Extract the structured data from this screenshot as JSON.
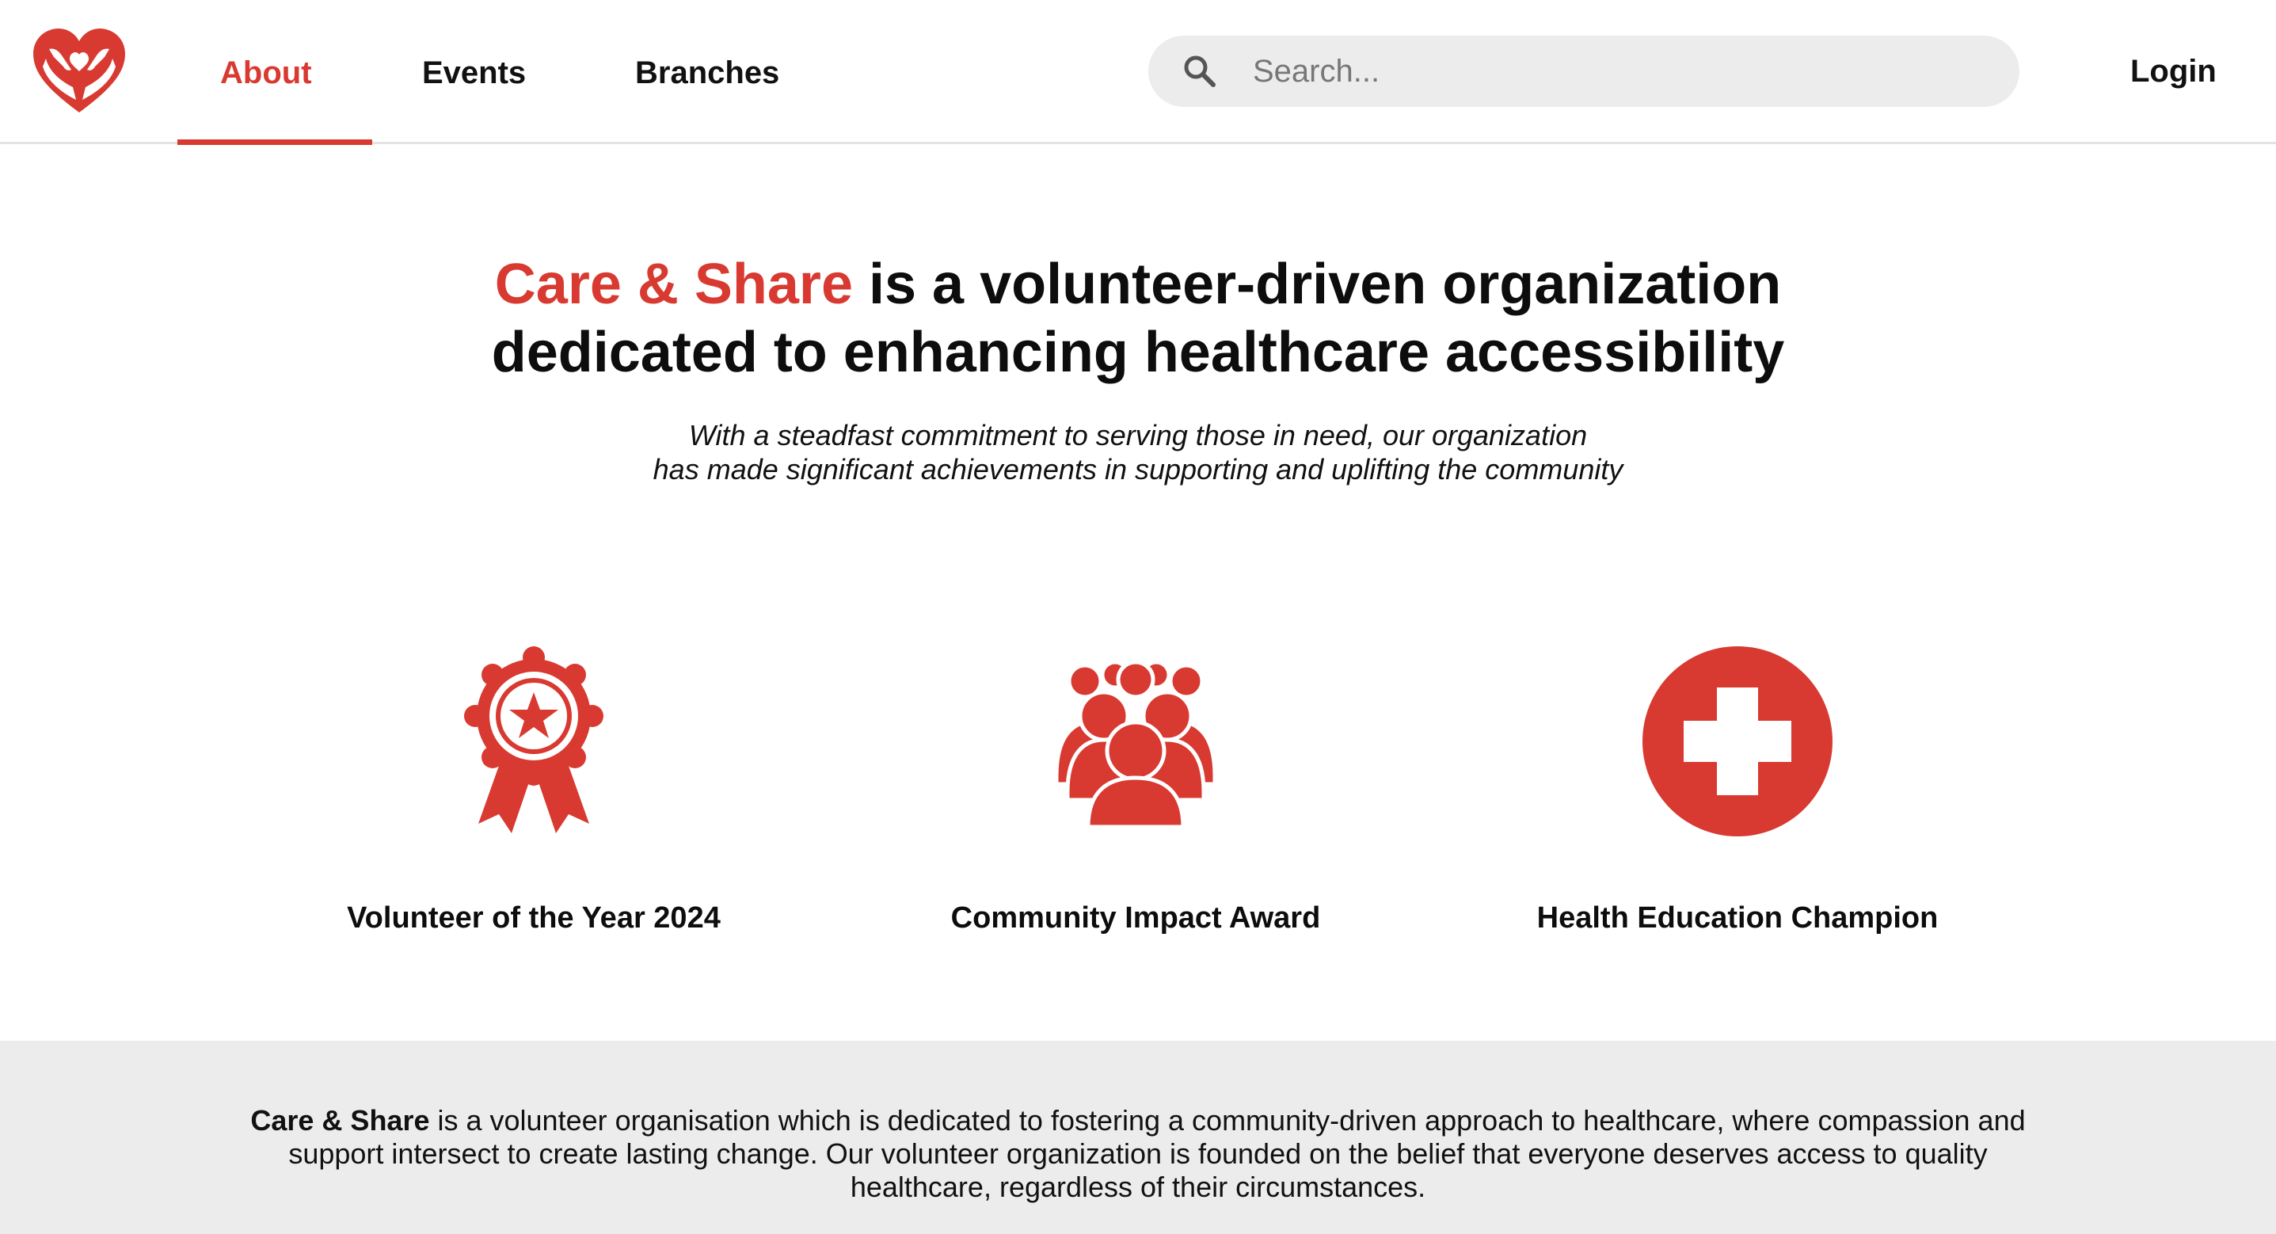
{
  "colors": {
    "accent": "#d83a31",
    "text": "#111111",
    "band": "#ececec"
  },
  "nav": {
    "logo_icon": "heart-hands-icon",
    "links": [
      {
        "label": "About",
        "active": true
      },
      {
        "label": "Events",
        "active": false
      },
      {
        "label": "Branches",
        "active": false
      }
    ],
    "search": {
      "placeholder": "Search...",
      "value": "",
      "icon": "search-icon"
    },
    "login_label": "Login"
  },
  "hero": {
    "brand": "Care & Share",
    "title_line1_rest": " is a volunteer-driven organization",
    "title_line2": "dedicated to enhancing healthcare accessibility",
    "subtitle_line1": "With a steadfast commitment to serving those in need, our organization",
    "subtitle_line2": "has made significant achievements in supporting and uplifting the community"
  },
  "awards": [
    {
      "icon": "award-ribbon-icon",
      "label": "Volunteer of the Year 2024"
    },
    {
      "icon": "community-group-icon",
      "label": "Community Impact Award"
    },
    {
      "icon": "medical-cross-icon",
      "label": "Health Education Champion"
    }
  ],
  "info": {
    "brand": "Care & Share",
    "text": " is a volunteer organisation which is dedicated to fostering a community-driven approach to healthcare, where compassion and support intersect to create lasting change. Our volunteer organization is founded on the belief that everyone deserves access to quality healthcare, regardless of their circumstances."
  }
}
